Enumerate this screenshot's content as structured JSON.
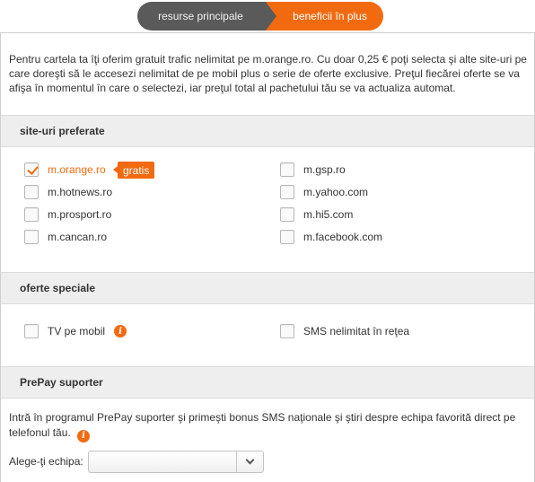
{
  "tabs": {
    "main": "resurse principale",
    "active": "beneficii în plus"
  },
  "intro_text": "Pentru cartela ta îţi oferim gratuit trafic nelimitat pe m.orange.ro. Cu doar 0,25 € poţi selecta şi alte site-uri pe care doreşti să le accesezi nelimitat de pe mobil plus o serie de oferte exclusive. Preţul fiecărei oferte se va afişa în momentul în care o selectezi, iar preţul total al pachetului tău se va actualiza automat.",
  "sections": {
    "sites": "site-uri preferate",
    "offers": "oferte speciale",
    "supporter": "PrePay suporter"
  },
  "sites": {
    "left": [
      {
        "label": "m.orange.ro",
        "checked": true
      },
      {
        "label": "m.hotnews.ro",
        "checked": false
      },
      {
        "label": "m.prosport.ro",
        "checked": false
      },
      {
        "label": "m.cancan.ro",
        "checked": false
      }
    ],
    "right": [
      {
        "label": "m.gsp.ro",
        "checked": false
      },
      {
        "label": "m.yahoo.com",
        "checked": false
      },
      {
        "label": "m.hi5.com",
        "checked": false
      },
      {
        "label": "m.facebook.com",
        "checked": false
      }
    ],
    "free_badge": "gratis"
  },
  "offers": {
    "tv": "TV pe mobil",
    "sms": "SMS nelimitat în reţea"
  },
  "supporter": {
    "text": "Intră în programul PrePay suporter şi primeşti bonus SMS naţionale şi ştiri despre echipa favorită direct pe telefonul tău.",
    "team_label": "Alege-ţi echipa:",
    "team_value": ""
  },
  "colors": {
    "accent": "#f26a10",
    "tab_inactive": "#5a5a5a",
    "section_bg": "#eeeeee"
  }
}
